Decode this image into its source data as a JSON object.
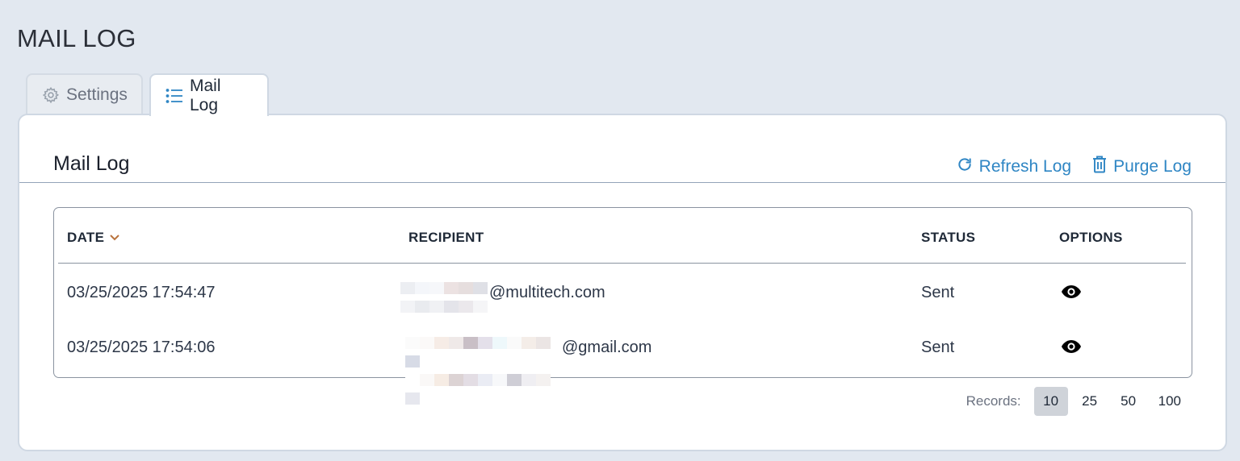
{
  "page": {
    "title": "MAIL LOG"
  },
  "tabs": [
    {
      "label": "Settings",
      "icon": "gear-icon",
      "active": false
    },
    {
      "label": "Mail Log",
      "icon": "list-icon",
      "active": true
    }
  ],
  "panel": {
    "title": "Mail Log",
    "actions": {
      "refresh_label": "Refresh Log",
      "purge_label": "Purge Log"
    }
  },
  "table": {
    "columns": {
      "date": "DATE",
      "recipient": "RECIPIENT",
      "status": "STATUS",
      "options": "OPTIONS"
    },
    "sort": {
      "column": "date",
      "direction": "desc",
      "indicator_color": "#b9733d"
    },
    "rows": [
      {
        "date": "03/25/2025 17:54:47",
        "recipient_domain": "@multitech.com",
        "status": "Sent"
      },
      {
        "date": "03/25/2025 17:54:06",
        "recipient_domain": "@gmail.com",
        "status": "Sent"
      }
    ]
  },
  "pager": {
    "label": "Records:",
    "options": [
      "10",
      "25",
      "50",
      "100"
    ],
    "selected": "10"
  },
  "colors": {
    "accent": "#2f86c4",
    "background": "#e2e8f0"
  }
}
